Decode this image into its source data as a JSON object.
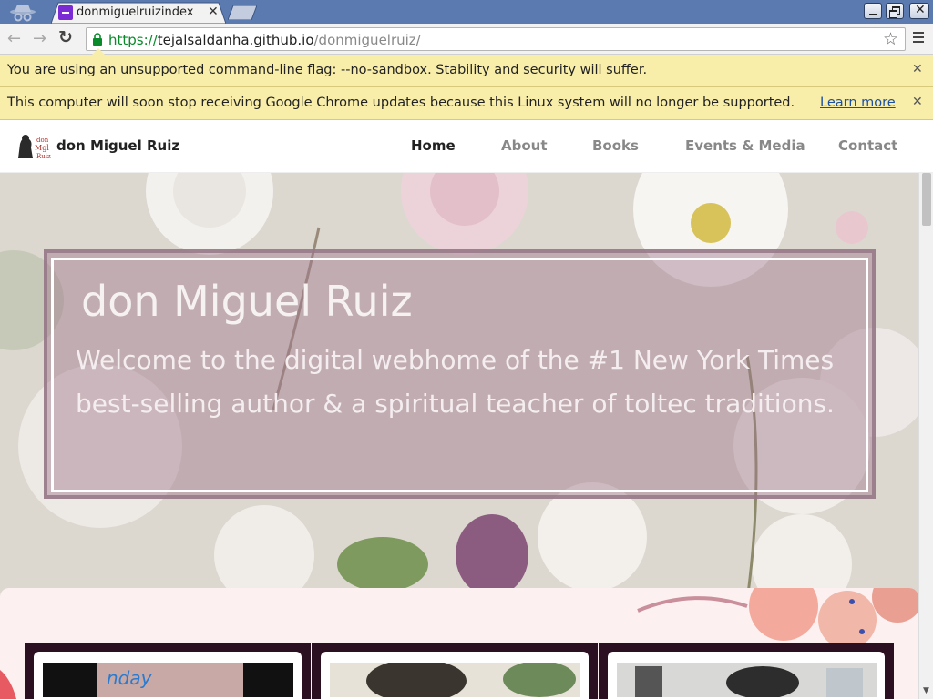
{
  "browser": {
    "tab_title": "donmiguelruizindex",
    "url_scheme": "https://",
    "url_host": "tejalsaldanha.github.io",
    "url_path": "/donmiguelruiz/",
    "icons": [
      "incognito-icon",
      "back-icon",
      "forward-icon",
      "reload-icon",
      "lock-icon",
      "star-icon",
      "menu-icon"
    ]
  },
  "infobars": [
    {
      "text": "You are using an unsupported command-line flag: --no-sandbox. Stability and security will suffer."
    },
    {
      "text": "This computer will soon stop receiving Google Chrome updates because this Linux system will no longer be supported.",
      "link": "Learn more"
    }
  ],
  "site": {
    "brand": "don Miguel Ruiz",
    "nav": {
      "home": "Home",
      "about": "About",
      "books": "Books",
      "events": "Events & Media",
      "contact": "Contact"
    },
    "hero": {
      "title": "don Miguel Ruiz",
      "subtitle": "Welcome to the digital webhome of the #1 New York Times best-selling author & a spiritual teacher of toltec traditions."
    }
  },
  "colors": {
    "infobar": "#f8eeaa",
    "url_scheme": "#0a8a2b",
    "hero_overlay": "#a0788c",
    "card_frame": "#2a1020"
  }
}
